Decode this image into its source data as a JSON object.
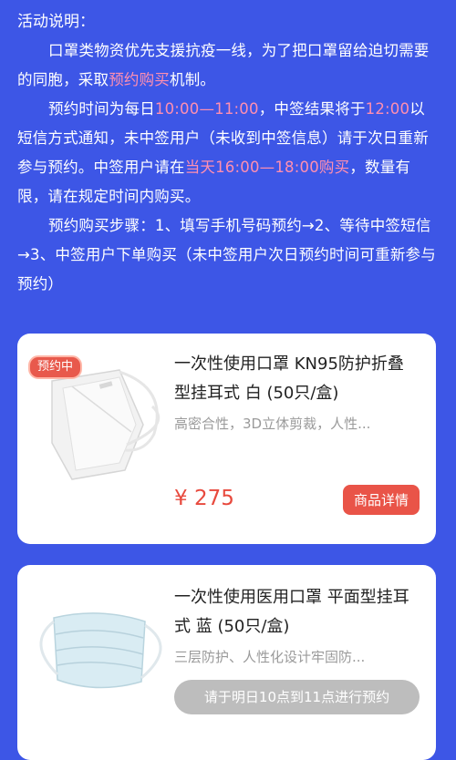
{
  "notice": {
    "title": "活动说明：",
    "p1a": "口罩类物资优先支援抗疫一线，为了把口罩留给迫切需要的同胞，采取",
    "p1b": "预约购买",
    "p1c": "机制。",
    "p2a": "预约时间为每日",
    "p2b": "10:00—11:00",
    "p2c": "，中签结果将于",
    "p2d": "12:00",
    "p2e": "以短信方式通知，未中签用户（未收到中签信息）请于次日重新参与预约。中签用户请在",
    "p2f": "当天16:00—18:00购买",
    "p2g": "，数量有限，请在规定时间内购买。",
    "p3": "预约购买步骤：1、填写手机号码预约→2、等待中签短信→3、中签用户下单购买（未中签用户次日预约时间可重新参与预约）"
  },
  "products": [
    {
      "badge": "预约中",
      "title": "一次性使用口罩 KN95防护折叠型挂耳式 白 (50只/盒)",
      "desc": "高密合性，3D立体剪裁，人性...",
      "price": "¥ 275",
      "button": "商品详情"
    },
    {
      "title": "一次性使用医用口罩 平面型挂耳式 蓝 (50只/盒)",
      "desc": "三层防护、人性化设计牢固防...",
      "button": "请于明日10点到11点进行预约"
    }
  ],
  "colors": {
    "background": "#3d56e6",
    "highlight": "#ff8fb0",
    "accent": "#e95448",
    "disabled": "#bdbdbd"
  }
}
